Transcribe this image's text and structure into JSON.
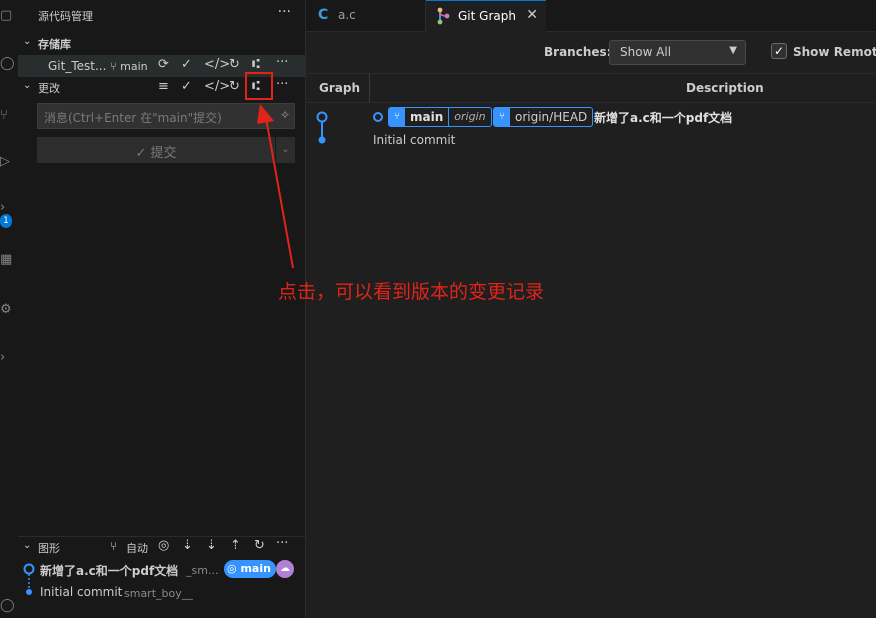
{
  "sidebar": {
    "title": "源代码管理",
    "repos_section": "存储库",
    "repo_name": "Git_Test...",
    "repo_branch": "main",
    "changes_section": "更改",
    "commit_placeholder": "消息(Ctrl+Enter 在\"main\"提交)",
    "commit_button": "✓ 提交",
    "graph_section": "图形",
    "graph_auto": "自动",
    "activity_badge": "1"
  },
  "graph_panel": {
    "commits": [
      {
        "message": "新增了a.c和一个pdf文档",
        "author": "_sm..."
      },
      {
        "message": "Initial commit",
        "author": "smart_boy__"
      }
    ],
    "main_badge": "main"
  },
  "tabs": [
    {
      "label": "a.c",
      "icon": "c-file-icon",
      "active": false
    },
    {
      "label": "Git Graph",
      "icon": "git-graph-icon",
      "active": true
    }
  ],
  "git_graph": {
    "branches_label": "Branches:",
    "branches_value": "Show All",
    "show_remote_label": "Show Remote",
    "columns": {
      "graph": "Graph",
      "description": "Description"
    },
    "rows": [
      {
        "refs": [
          {
            "name": "main",
            "remote": "origin"
          },
          {
            "name": "origin/HEAD"
          }
        ],
        "message": "新增了a.c和一个pdf文档"
      },
      {
        "refs": [],
        "message": "Initial commit"
      }
    ]
  },
  "annotation": {
    "text": "点击，可以看到版本的变更记录",
    "color": "#e0241a"
  },
  "colors": {
    "accent": "#0078d4",
    "ref_blue": "#3794ff",
    "graph_line": "#3794ff",
    "annotation_red": "#e0241a",
    "remote_purple": "#b180d7"
  }
}
